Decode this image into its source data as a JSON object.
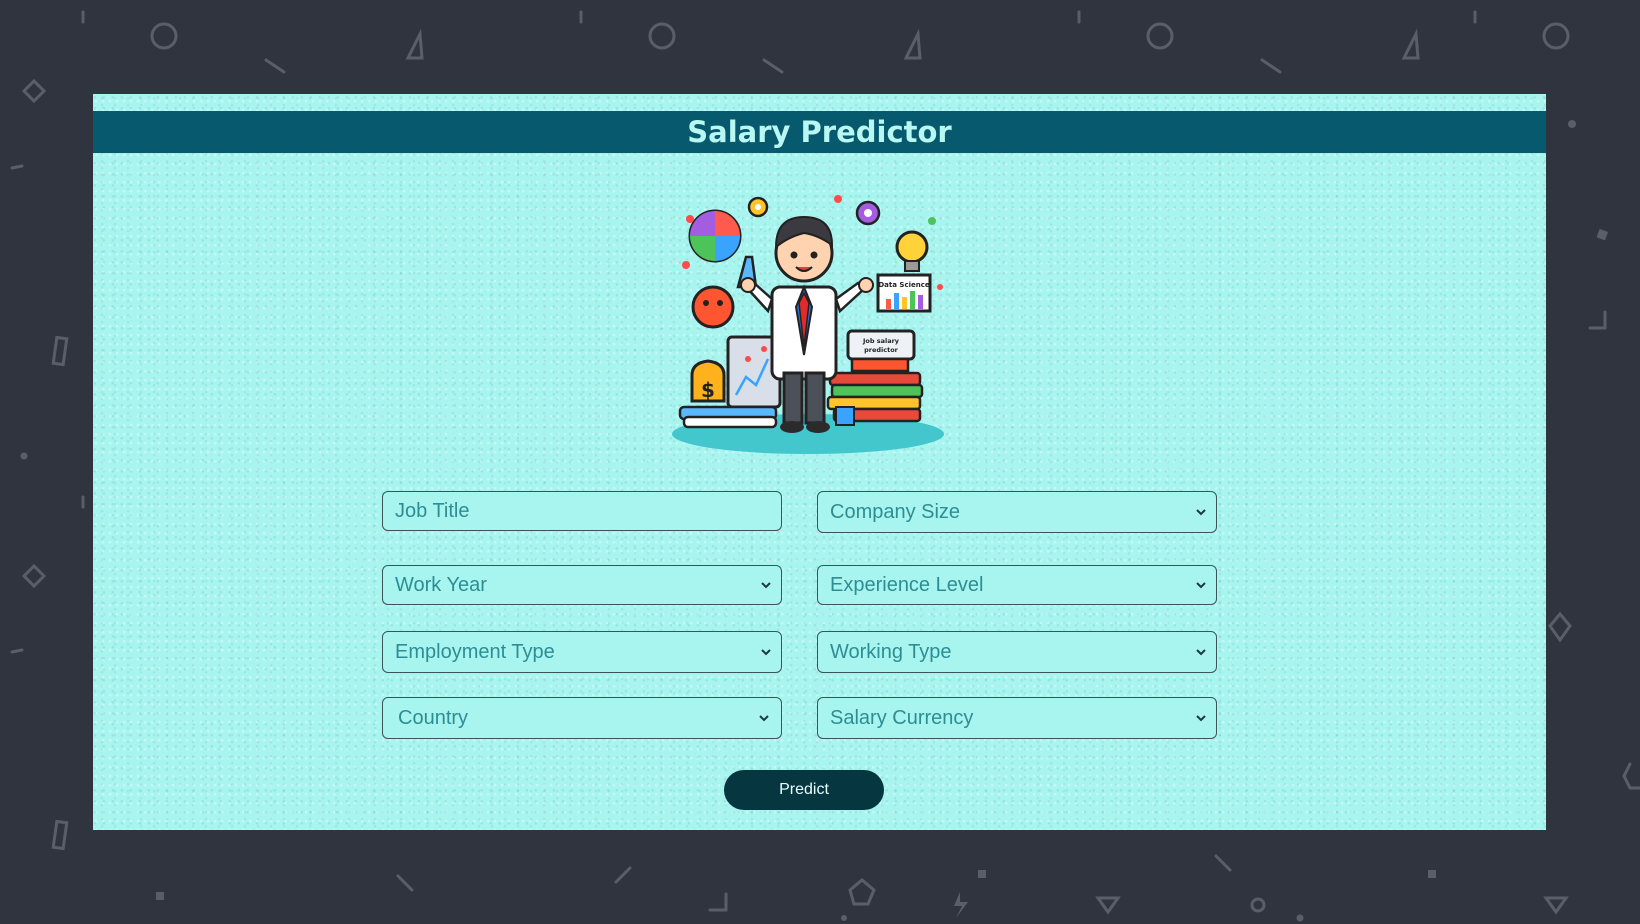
{
  "header": {
    "title": "Salary Predictor"
  },
  "hero_image": {
    "icon": "data-scientist-illustration-icon",
    "board_text": "Data Science",
    "sign_text_line1": "Job salary",
    "sign_text_line2": "predictor",
    "bag_symbol": "$"
  },
  "form": {
    "job_title": {
      "placeholder": "Job Title",
      "value": ""
    },
    "company_size": {
      "selected": "Company Size"
    },
    "work_year": {
      "selected": "Work Year"
    },
    "experience_level": {
      "selected": "Experience Level"
    },
    "employment_type": {
      "selected": "Employment Type"
    },
    "working_type": {
      "selected": "Working Type"
    },
    "country": {
      "selected": "Country"
    },
    "salary_currency": {
      "selected": "Salary Currency"
    },
    "predict_label": "Predict"
  },
  "colors": {
    "page_background": "#30343e",
    "panel_background": "#a8f5f0",
    "header_background": "#075a6e",
    "title_text": "#b9f7f2",
    "field_text": "#2e8d93",
    "button_background": "#063640"
  }
}
